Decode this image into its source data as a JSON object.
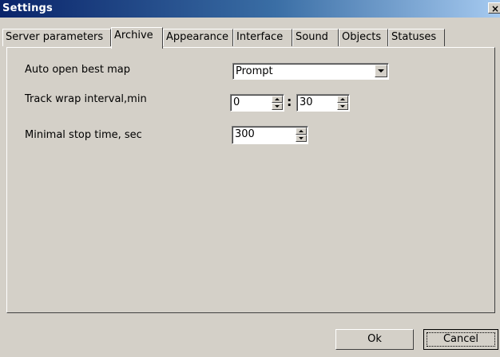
{
  "window": {
    "title": "Settings",
    "close_glyph": "×"
  },
  "tabs": [
    {
      "label": "Server parameters",
      "active": false
    },
    {
      "label": "Archive",
      "active": true
    },
    {
      "label": "Appearance",
      "active": false
    },
    {
      "label": "Interface",
      "active": false
    },
    {
      "label": "Sound",
      "active": false
    },
    {
      "label": "Objects",
      "active": false
    },
    {
      "label": "Statuses",
      "active": false
    }
  ],
  "archive": {
    "auto_open": {
      "label": "Auto open best map",
      "value": "Prompt"
    },
    "track_wrap": {
      "label": "Track wrap interval,min",
      "hours": "0",
      "separator": ":",
      "minutes": "30"
    },
    "min_stop": {
      "label": "Minimal stop time, sec",
      "value": "300"
    }
  },
  "buttons": {
    "ok": "Ok",
    "cancel": "Cancel"
  },
  "colors": {
    "window_bg": "#d4d0c8",
    "titlebar_start": "#0a246a",
    "titlebar_end": "#a6caf0"
  }
}
